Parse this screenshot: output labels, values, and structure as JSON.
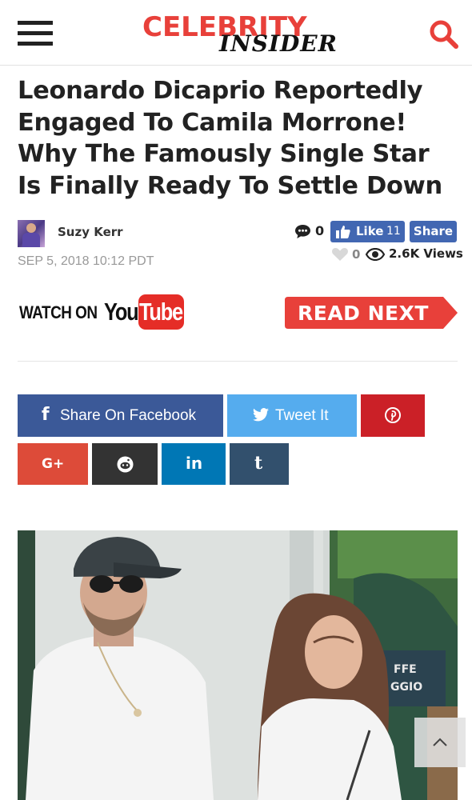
{
  "header": {
    "logo_top": "CELEBRITY",
    "logo_bottom": "INSIDER",
    "menu_icon": "hamburger-menu-icon",
    "search_icon": "search-icon"
  },
  "article": {
    "title": "Leonardo Dicaprio Reportedly Engaged To Camila Morrone! Why The Famously Single Star Is Finally Ready To Settle Down",
    "author": "Suzy Kerr",
    "date": "SEP 5, 2018 10:12 PDT",
    "comment_count": "0",
    "like_label": "Like",
    "like_count": "11",
    "share_label": "Share",
    "heart_count": "0",
    "views": "2.6K Views"
  },
  "promo": {
    "watch_on": "WATCH ON",
    "you": "You",
    "tube": "Tube",
    "read_next": "READ NEXT"
  },
  "share_buttons": {
    "facebook": "Share On Facebook",
    "twitter": "Tweet It",
    "googleplus_icon": "G+",
    "linkedin_icon": "in",
    "tumblr_icon": "t"
  },
  "photo_overlay_text": {
    "line1": "FFE",
    "line2": "GGIO"
  },
  "colors": {
    "brand_red": "#e8403a",
    "facebook": "#3b5998",
    "facebook_button": "#4267b2",
    "twitter": "#55acee",
    "pinterest": "#cb2027",
    "googleplus": "#dd4b39",
    "reddit": "#333333",
    "linkedin": "#0077b5",
    "tumblr": "#32506d",
    "youtube_red": "#e52d27"
  }
}
